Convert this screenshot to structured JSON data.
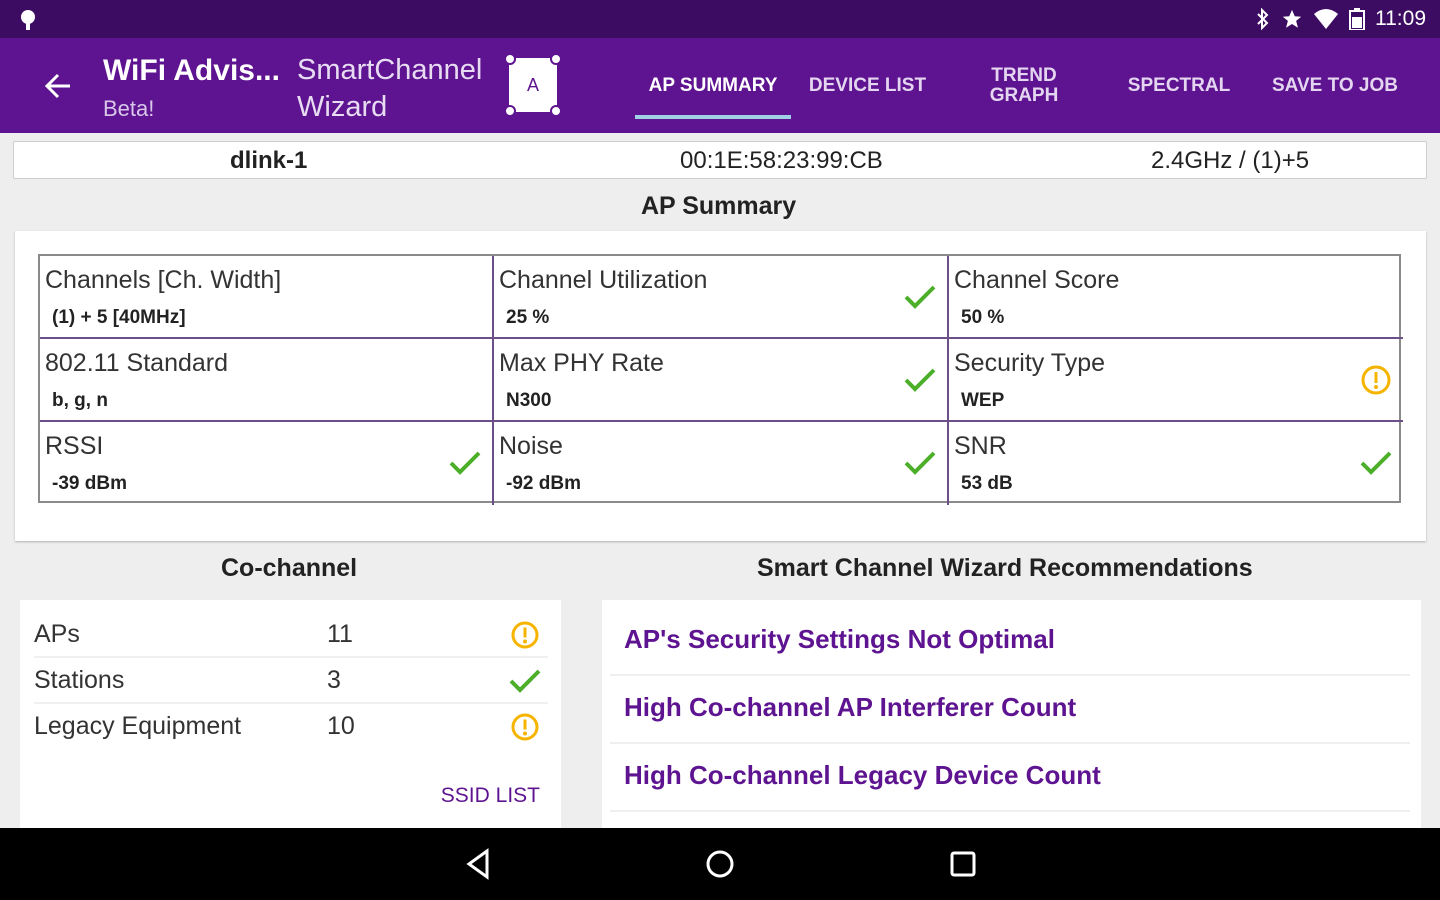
{
  "status_bar": {
    "time": "11:09",
    "icons": [
      "location-pin-icon",
      "bluetooth-icon",
      "star-icon",
      "wifi-icon",
      "battery-icon"
    ]
  },
  "toolbar": {
    "app_title": "WiFi Advis...",
    "app_subtitle": "Beta!",
    "wizard_line1": "SmartChannel",
    "wizard_line2": "Wizard",
    "wizard_icon_letter": "A",
    "tabs": [
      {
        "label": "AP SUMMARY",
        "active": true
      },
      {
        "label": "DEVICE LIST",
        "active": false
      },
      {
        "label_line1": "TREND",
        "label_line2": "GRAPH",
        "active": false
      },
      {
        "label": "SPECTRAL",
        "active": false
      },
      {
        "label": "SAVE TO JOB",
        "active": false
      }
    ]
  },
  "ap_info": {
    "ssid": "dlink-1",
    "bssid": "00:1E:58:23:99:CB",
    "band_channel": "2.4GHz / (1)+5"
  },
  "summary": {
    "title": "AP Summary",
    "cells": [
      {
        "label": "Channels [Ch. Width]",
        "value": "(1) + 5 [40MHz]",
        "status": "none"
      },
      {
        "label": "Channel Utilization",
        "value": "25 %",
        "status": "ok"
      },
      {
        "label": "Channel Score",
        "value": "50 %",
        "status": "none"
      },
      {
        "label": "802.11 Standard",
        "value": "b, g, n",
        "status": "none"
      },
      {
        "label": "Max PHY Rate",
        "value": "N300",
        "status": "ok"
      },
      {
        "label": "Security Type",
        "value": "WEP",
        "status": "warning"
      },
      {
        "label": "RSSI",
        "value": "-39 dBm",
        "status": "ok"
      },
      {
        "label": "Noise",
        "value": "-92 dBm",
        "status": "ok"
      },
      {
        "label": "SNR",
        "value": "53 dB",
        "status": "ok"
      }
    ]
  },
  "cochannel": {
    "title": "Co-channel",
    "rows": [
      {
        "name": "APs",
        "count": "11",
        "status": "warning"
      },
      {
        "name": "Stations",
        "count": "3",
        "status": "ok"
      },
      {
        "name": "Legacy Equipment",
        "count": "10",
        "status": "warning"
      }
    ],
    "link": "SSID LIST"
  },
  "recommendations": {
    "title": "Smart Channel Wizard Recommendations",
    "items": [
      "AP's Security Settings Not Optimal",
      "High Co-channel AP Interferer Count",
      "High Co-channel Legacy Device Count"
    ]
  },
  "colors": {
    "status_bar": "#3c0c62",
    "toolbar": "#5e1490",
    "ok": "#4caf2a",
    "warning": "#f5b400",
    "link": "#5e1490"
  }
}
